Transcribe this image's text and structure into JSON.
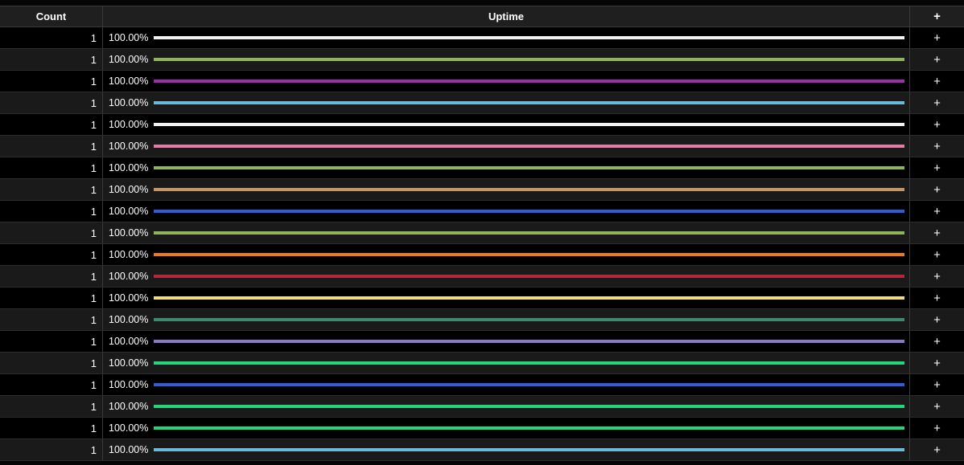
{
  "table": {
    "headers": {
      "count": "Count",
      "uptime": "Uptime",
      "add": "+"
    },
    "add_label": "+",
    "rows": [
      {
        "count": "1",
        "uptime": "100.00%",
        "uptime_fraction": 1.0,
        "color": "#f2f2f2"
      },
      {
        "count": "1",
        "uptime": "100.00%",
        "uptime_fraction": 1.0,
        "color": "#8fb55c"
      },
      {
        "count": "1",
        "uptime": "100.00%",
        "uptime_fraction": 1.0,
        "color": "#9b2fae"
      },
      {
        "count": "1",
        "uptime": "100.00%",
        "uptime_fraction": 1.0,
        "color": "#6cb8d8"
      },
      {
        "count": "1",
        "uptime": "100.00%",
        "uptime_fraction": 1.0,
        "color": "#f2f2f2"
      },
      {
        "count": "1",
        "uptime": "100.00%",
        "uptime_fraction": 1.0,
        "color": "#e17da6"
      },
      {
        "count": "1",
        "uptime": "100.00%",
        "uptime_fraction": 1.0,
        "color": "#8fb55c"
      },
      {
        "count": "1",
        "uptime": "100.00%",
        "uptime_fraction": 1.0,
        "color": "#c4946a"
      },
      {
        "count": "1",
        "uptime": "100.00%",
        "uptime_fraction": 1.0,
        "color": "#2c5fe0"
      },
      {
        "count": "1",
        "uptime": "100.00%",
        "uptime_fraction": 1.0,
        "color": "#8fb55c"
      },
      {
        "count": "1",
        "uptime": "100.00%",
        "uptime_fraction": 1.0,
        "color": "#ee7a1e"
      },
      {
        "count": "1",
        "uptime": "100.00%",
        "uptime_fraction": 1.0,
        "color": "#b0283a"
      },
      {
        "count": "1",
        "uptime": "100.00%",
        "uptime_fraction": 1.0,
        "color": "#f3df70"
      },
      {
        "count": "1",
        "uptime": "100.00%",
        "uptime_fraction": 1.0,
        "color": "#3f8a6f"
      },
      {
        "count": "1",
        "uptime": "100.00%",
        "uptime_fraction": 1.0,
        "color": "#8b78c8"
      },
      {
        "count": "1",
        "uptime": "100.00%",
        "uptime_fraction": 1.0,
        "color": "#22d67c"
      },
      {
        "count": "1",
        "uptime": "100.00%",
        "uptime_fraction": 1.0,
        "color": "#2c5fe0"
      },
      {
        "count": "1",
        "uptime": "100.00%",
        "uptime_fraction": 1.0,
        "color": "#22d67c"
      },
      {
        "count": "1",
        "uptime": "100.00%",
        "uptime_fraction": 1.0,
        "color": "#22d67c"
      },
      {
        "count": "1",
        "uptime": "100.00%",
        "uptime_fraction": 1.0,
        "color": "#6cb8d8"
      }
    ]
  }
}
